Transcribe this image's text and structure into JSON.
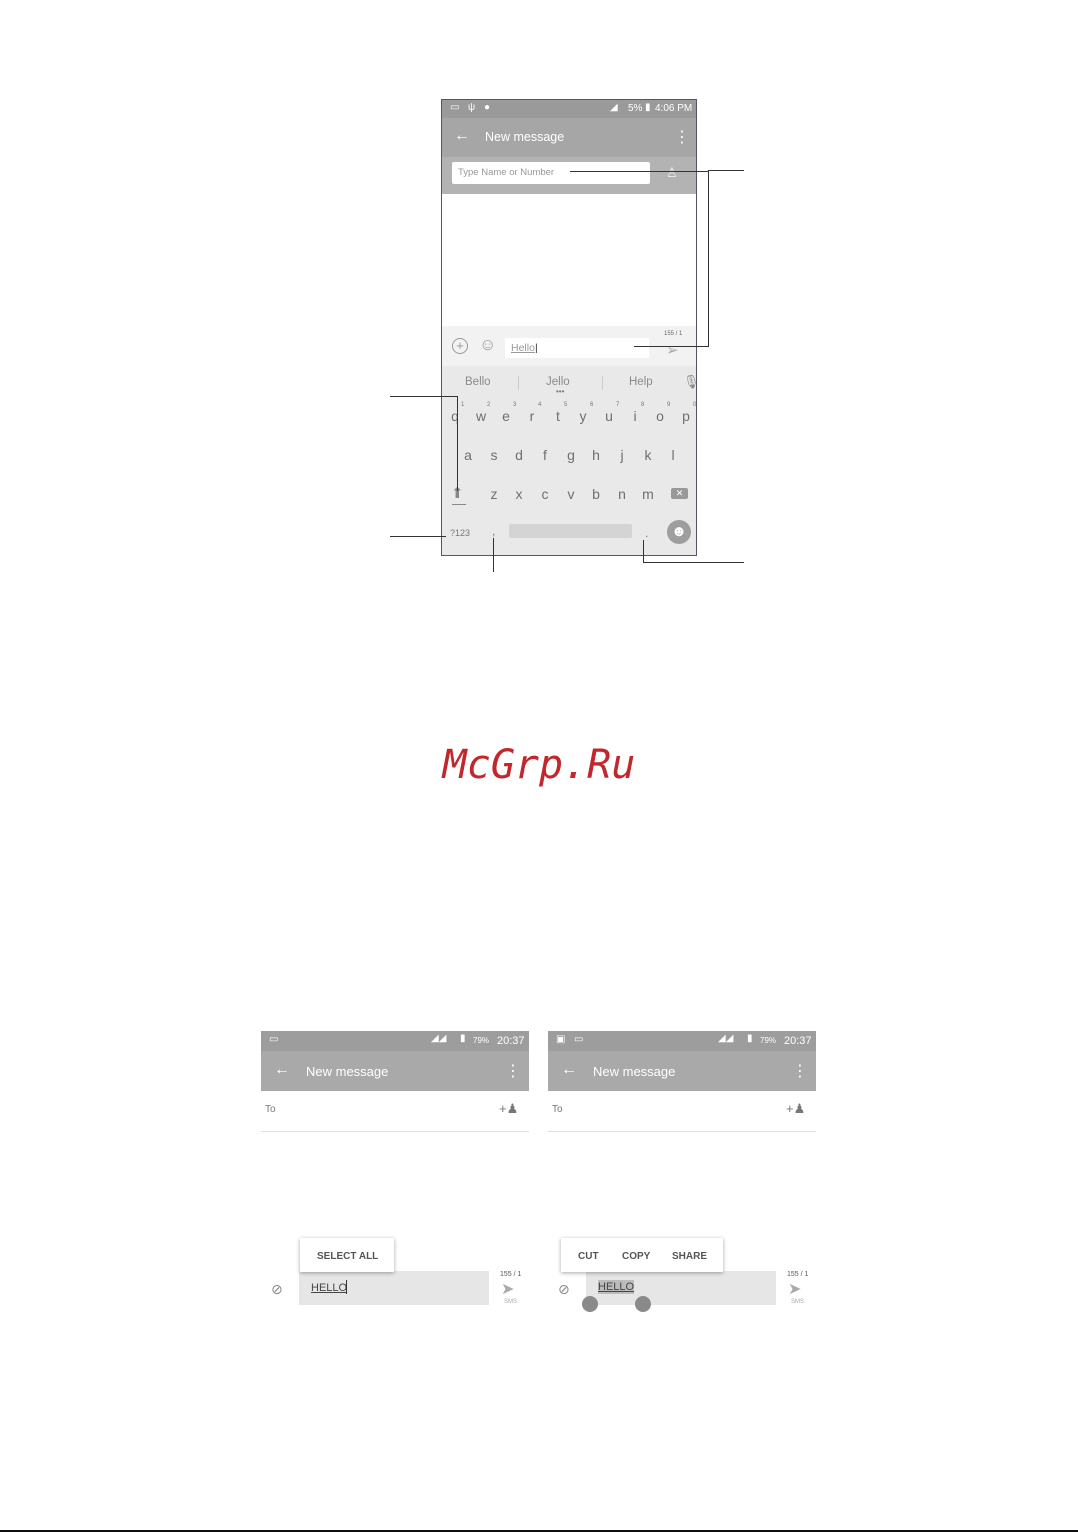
{
  "top_phone": {
    "status": {
      "battery": "5%",
      "time": "4:06 PM"
    },
    "appbar": {
      "title": "New message"
    },
    "to_placeholder": "Type Name or Number",
    "compose": {
      "text": "Hello",
      "counter": "155 / 1"
    },
    "suggestions": [
      "Bello",
      "Jello",
      "Help"
    ],
    "keyboard": {
      "row1": [
        "q",
        "w",
        "e",
        "r",
        "t",
        "y",
        "u",
        "i",
        "o",
        "p"
      ],
      "row1_hints": [
        "1",
        "2",
        "3",
        "4",
        "5",
        "6",
        "7",
        "8",
        "9",
        "0"
      ],
      "row2": [
        "a",
        "s",
        "d",
        "f",
        "g",
        "h",
        "j",
        "k",
        "l"
      ],
      "row3": [
        "z",
        "x",
        "c",
        "v",
        "b",
        "n",
        "m"
      ],
      "symbols_label": "?123",
      "comma": ",",
      "period": "."
    }
  },
  "watermark": "McGrp.Ru",
  "screen_a": {
    "status": {
      "battery": "79%",
      "time": "20:37"
    },
    "title": "New message",
    "to_label": "To",
    "popup": [
      "SELECT ALL"
    ],
    "text": "HELLO",
    "counter": "155 / 1",
    "send_label": "SMS"
  },
  "screen_b": {
    "status": {
      "battery": "79%",
      "time": "20:37"
    },
    "title": "New message",
    "to_label": "To",
    "popup": [
      "CUT",
      "COPY",
      "SHARE"
    ],
    "text": "HELLO",
    "counter": "155 / 1",
    "send_label": "SMS"
  }
}
